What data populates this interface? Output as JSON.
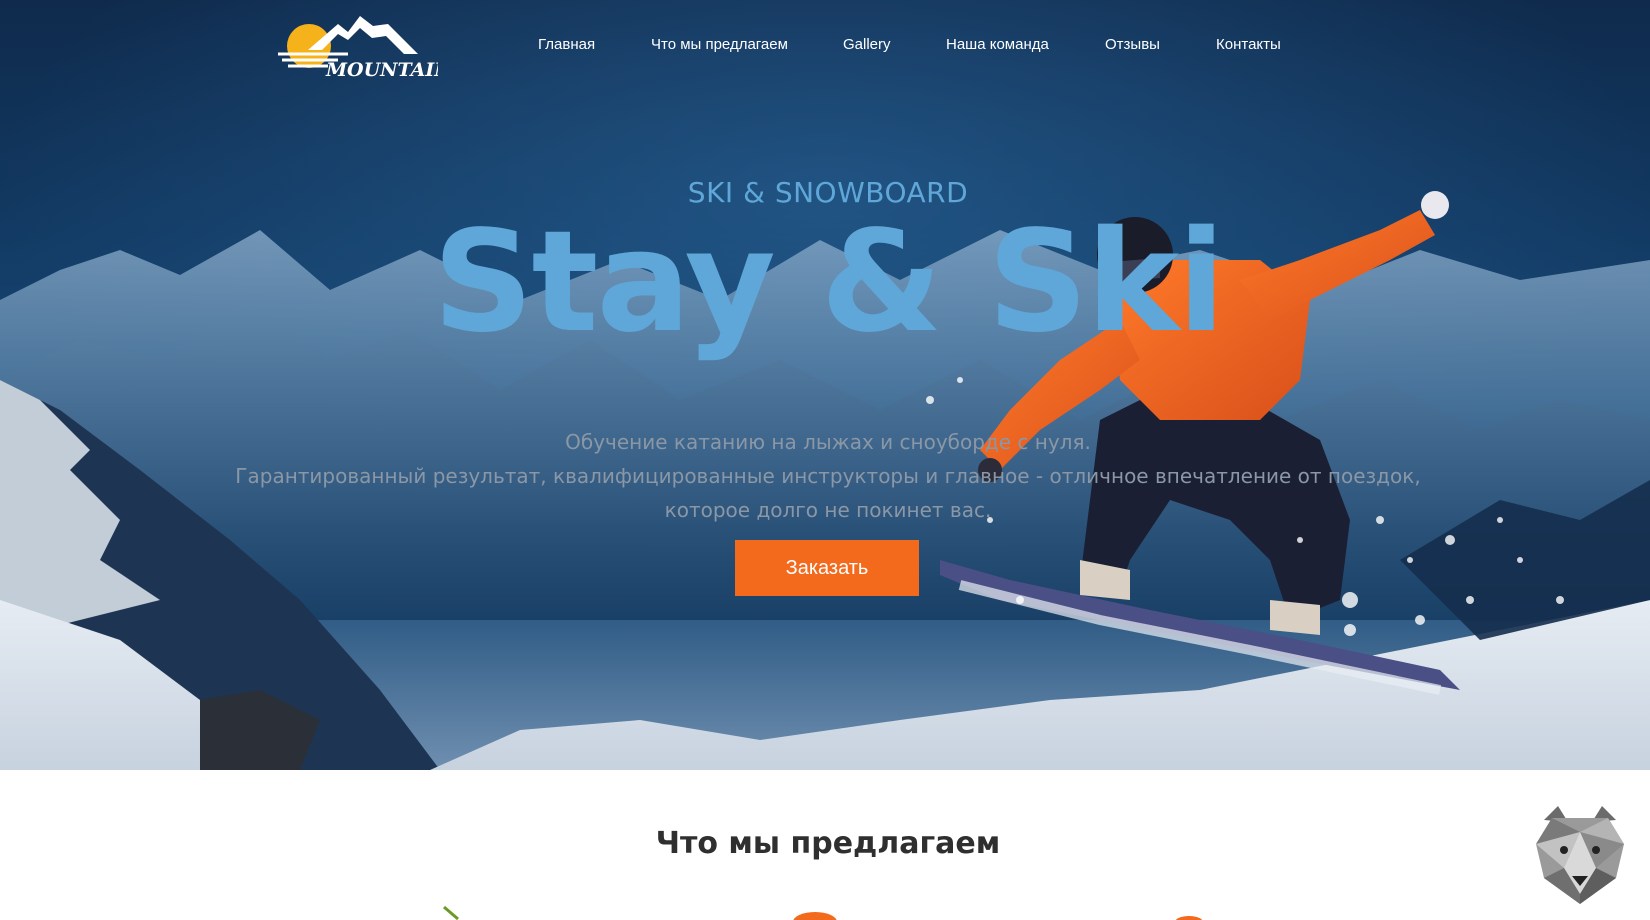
{
  "header": {
    "logo_text": "MOUNTAIN",
    "nav": [
      {
        "label": "Главная"
      },
      {
        "label": "Что мы предлагаем"
      },
      {
        "label": "Gallery"
      },
      {
        "label": "Наша команда"
      },
      {
        "label": "Отзывы"
      },
      {
        "label": "Контакты"
      }
    ]
  },
  "hero": {
    "eyebrow": "SKI & SNOWBOARD",
    "headline": "Stay & Ski",
    "subtitle_lines": [
      "Обучение катанию на лыжах и сноуборде с нуля.",
      "Гарантированный результат, квалифицированные инструкторы и главное - отличное впечатление от поездок,",
      "которое долго не покинет вас."
    ],
    "cta_label": "Заказать"
  },
  "offers": {
    "title": "Что мы предлагаем"
  },
  "colors": {
    "accent": "#f36a1c",
    "headline_blue": "#5ea7d8",
    "hero_dark": "#0f2a4c"
  },
  "icons": {
    "chat_widget": "bear-avatar-icon"
  }
}
